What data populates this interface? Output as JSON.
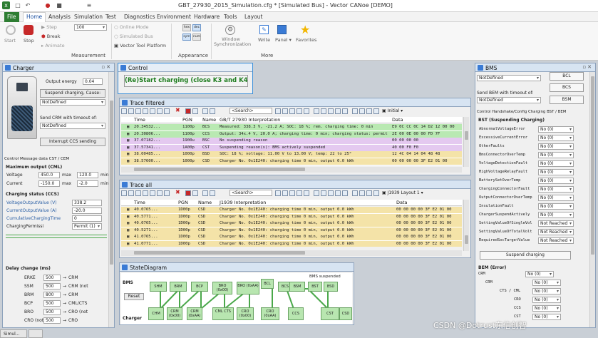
{
  "app": {
    "title": "GBT_27930_2015_Simulation.cfg * [Simulated Bus] - Vector CANoe [DEMO]"
  },
  "menu": [
    "File",
    "Home",
    "Analysis",
    "Simulation",
    "Test",
    "Diagnostics",
    "Environment",
    "Hardware",
    "Tools",
    "Layout"
  ],
  "ribbon": {
    "start": "Start",
    "stop": "Stop",
    "step": "Step",
    "break": "Break",
    "animate": "Animate",
    "speed": "100",
    "online_mode": "Online Mode",
    "simulated_bus": "Simulated Bus",
    "vector_tool_platform": "Vector Tool Platform",
    "measurement": "Measurement",
    "appearance": "Appearance",
    "more": "More",
    "window_sync": "Window Synchronization",
    "write": "Write",
    "panel": "Panel",
    "favorites": "Favorites",
    "hex": "hex",
    "dec": "dec",
    "sym": "sym",
    "num": "num"
  },
  "charger": {
    "title": "Charger",
    "output_energy_label": "Output energy",
    "output_energy": "0.04",
    "suspend_btn": "Suspend charging, Cause:",
    "not_defined": "NotDefined",
    "send_crm_label": "Send CRM with timeout of:",
    "not_defined2": "NotDefined",
    "interrupt_btn": "Interrupt CCS sending",
    "tabs": "Control  Message data CST / CEM",
    "max_output": "Maximum output (CML)",
    "voltage": "Voltage",
    "v_min": "450.0",
    "v_max": "120.0",
    "max": "max",
    "min": "min",
    "current": "Current",
    "c_min": "-150.0",
    "c_max": "-2.0",
    "ccs_title": "Charging status (CCS)",
    "ccs_rows": [
      [
        "VoltageOutputValue (V)",
        "338.2"
      ],
      [
        "CurrentOutputValue (A)",
        "-20.0"
      ],
      [
        "CumulativeChargingTime",
        "0"
      ],
      [
        "ChargingPermissi",
        "Permit (1)"
      ]
    ],
    "delay_title": "Delay change (ms)",
    "delays": [
      [
        "ERKE",
        "500",
        "CRM"
      ],
      [
        "SSM",
        "500",
        "CRM (not"
      ],
      [
        "BRM",
        "800",
        "CRM"
      ],
      [
        "BCP",
        "500",
        "CML/CTS"
      ],
      [
        "BRO",
        "500",
        "CRO (not"
      ],
      [
        "CRO (not",
        "500",
        "CRO"
      ]
    ]
  },
  "control": {
    "title": "Control",
    "start_btn": "(Re)Start charging (close K3 and K4)"
  },
  "trace_filtered": {
    "title": "Trace filtered",
    "search": "<Search>",
    "initial": "Initial",
    "columns": [
      "Time",
      "PGN",
      "Name",
      "GB/T 27930 Interpretation",
      "Data"
    ],
    "rows": [
      {
        "time": "20.34532...",
        "pgn": "1100p",
        "name": "BCS",
        "interp": "Measured: 338.3 V, -21.2 A; SOC: 18 %; rem. charging time: 0 min",
        "data": "E9 0C CC 0C 14 D2 12 00 00",
        "color": "#b9e9b2"
      },
      {
        "time": "20.30806...",
        "pgn": "1100p",
        "name": "CCS",
        "interp": "Output: 34x.4 V, 20.0 A; charging time: 0 min; charging status: permit",
        "data": "2E 00 0E 00 00 FD 7F",
        "color": "#b9e9b2"
      },
      {
        "time": "37.07182...",
        "pgn": "1900u",
        "name": "BSC",
        "interp": "No suspending reason",
        "data": "00 00 00 00",
        "color": "#e4c9f0"
      },
      {
        "time": "37.57341...",
        "pgn": "1A00p",
        "name": "CST",
        "interp": "Suspending reason(s): BMS actively suspended",
        "data": "40 00 F0 F0",
        "color": "#e4c9f0"
      },
      {
        "time": "38.00485...",
        "pgn": "1000p",
        "name": "BSD",
        "interp": "SOC: 18 %; voltage: 11.00 V to 13.00 V; temp: 22 to 25°",
        "data": "12 4C 04 14 04 48 48",
        "color": "#f4e3a8"
      },
      {
        "time": "38.57600...",
        "pgn": "1000p",
        "name": "CSD",
        "interp": "Charger No. 0x1E240: charging time 0 min, output  0.0 kWh",
        "data": "00 00 00 00 3F E2 01 00",
        "color": "#f4e3a8"
      }
    ]
  },
  "trace_all": {
    "title": "Trace all",
    "search": "<Search>",
    "layout": "J1939 Layout 1",
    "columns": [
      "Time",
      "PGN",
      "Name",
      "J1939 Interpretation",
      "Data"
    ],
    "rows": [
      {
        "time": "40.0765...",
        "pgn": "1D00p",
        "name": "CSD",
        "interp": "Charger No. 0x1E240: charging time 0 min, output    0.0 kWh",
        "data": "00 00 00 00 3F E2 01 00"
      },
      {
        "time": "40.5771...",
        "pgn": "1D00p",
        "name": "CSD",
        "interp": "Charger No. 0x1E240: charging time 0 min, output    0.0 kWh",
        "data": "00 00 00 00 3F E2 01 00"
      },
      {
        "time": "40.0765...",
        "pgn": "1D00p",
        "name": "CSD",
        "interp": "Charger No. 0x1E240: charging time 0 min, output    0.0 kWh",
        "data": "00 00 00 00 3F E2 01 00"
      },
      {
        "time": "40.5271...",
        "pgn": "1D00p",
        "name": "CSD",
        "interp": "Charger No. 0x1E240: charging time 0 min, output    0.0 kWh",
        "data": "00 00 00 00 3F E2 01 00"
      },
      {
        "time": "41.0765...",
        "pgn": "1D00p",
        "name": "CSD",
        "interp": "Charger No. 0x1E240: charging time 0 min, output    0.0 kWh",
        "data": "00 00 00 00 3F E2 01 00"
      },
      {
        "time": "41.0771...",
        "pgn": "1D00p",
        "name": "CSD",
        "interp": "Charger No. 0x1E240: charging time 0 min, output    0.0 kWh",
        "data": "00 00 00 00 3F E2 01 00"
      }
    ]
  },
  "state": {
    "title": "StateDiagram",
    "bms": "BMS",
    "charger": "Charger",
    "reset": "Reset",
    "bms_suspended": "BMS suspended",
    "bms_states": [
      "SHM",
      "BRM",
      "BCP",
      "BRO (0x00)",
      "BRO (0xAA)",
      "BCL",
      "BCS",
      "BSM",
      "BST",
      "BSD"
    ],
    "charger_states": [
      "CHM",
      "CRM (0x00)",
      "CRM (0xAA)",
      "CML CTS",
      "CRO (0x00)",
      "CRO (0xAA)",
      "CCS",
      "CST",
      "CSD"
    ]
  },
  "bms": {
    "title": "BMS",
    "not_defined": "NotDefined",
    "bcl_btn": "BCL",
    "bcs_btn": "BCS",
    "bsm_btn": "BSM",
    "send_bem_label": "Send BEM with timeout of:",
    "not_defined2": "NotDefined",
    "tabs": "Control Handshake/Config Charging BST / BEM",
    "bst_title": "BST (Suspending Charging)",
    "bst_rows": [
      [
        "AbnormalVoltageError",
        "No (0)"
      ],
      [
        "ExcessiveCurrentError",
        "No (0)"
      ],
      [
        "OtherFaults",
        "No (0)"
      ],
      [
        "BmsConnectorOverTemp",
        "No (0)"
      ],
      [
        "VoltageDetectionFault",
        "No (0)"
      ],
      [
        "HighVoltageRelayFault",
        "No (0)"
      ],
      [
        "BatterySetOverTemp",
        "No (0)"
      ],
      [
        "ChargingConnectorFault",
        "No (0)"
      ],
      [
        "OutputConnectorOverTemp",
        "No (0)"
      ],
      [
        "InsulationFault",
        "No (0)"
      ],
      [
        "ChargerSuspendActively",
        "No (0)"
      ],
      [
        "SettingValueOfSingleVol",
        "Not Reached"
      ],
      [
        "SettingValueOfTotalVolt",
        "Not Reached"
      ],
      [
        "RequiredSocTargetValue",
        "Not Reached"
      ]
    ],
    "suspend_btn": "Suspend charging",
    "bem_title": "BEM (Error)",
    "bem_rows": [
      [
        "CRM",
        "No (0)"
      ],
      [
        "CRM",
        "No (0)"
      ],
      [
        "CTS / CML",
        "No (0)"
      ],
      [
        "CRO",
        "No (0)"
      ],
      [
        "CCS",
        "No (0)"
      ],
      [
        "CST",
        "No (0)"
      ]
    ]
  },
  "taskbar": {
    "item": "Simul..."
  },
  "watermark": "CSDN @Dotrust东信创智"
}
